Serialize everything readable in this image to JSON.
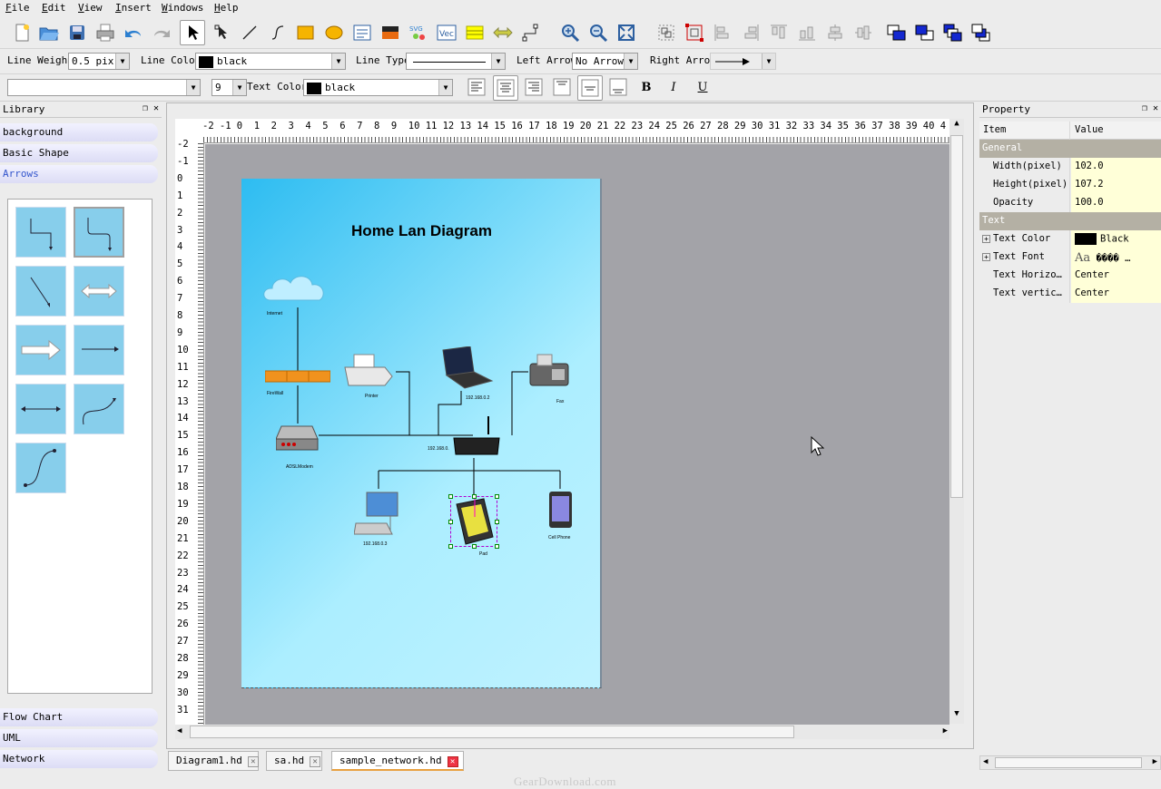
{
  "menu": [
    {
      "key": "F",
      "rest": "ile"
    },
    {
      "key": "E",
      "rest": "dit"
    },
    {
      "key": "V",
      "rest": "iew"
    },
    {
      "key": "I",
      "rest": "nsert"
    },
    {
      "key": "W",
      "rest": "indows"
    },
    {
      "key": "H",
      "rest": "elp"
    }
  ],
  "toolbar_line": {
    "line_weight_label": "Line Weight",
    "line_weight_value": "0.5 pix",
    "line_color_label": "Line Color",
    "line_color_value": "black",
    "line_type_label": "Line Type",
    "left_arrow_label": "Left Arrow",
    "left_arrow_value": "No Arrow",
    "right_arrow_label": "Right Arrow"
  },
  "toolbar_text": {
    "font_value": "",
    "size_value": "9",
    "text_color_label": "Text Color",
    "text_color_value": "black",
    "bold": "B",
    "italic": "I",
    "underline": "U"
  },
  "library": {
    "title": "Library",
    "categories_top": [
      "background",
      "Basic Shape",
      "Arrows"
    ],
    "categories_bottom": [
      "Flow Chart",
      "UML",
      "Network"
    ]
  },
  "ruler": {
    "h": [
      "-2",
      "-1",
      "0",
      "1",
      "2",
      "3",
      "4",
      "5",
      "6",
      "7",
      "8",
      "9",
      "10",
      "11",
      "12",
      "13",
      "14",
      "15",
      "16",
      "17",
      "18",
      "19",
      "20",
      "21",
      "22",
      "23",
      "24",
      "25",
      "26",
      "27",
      "28",
      "29",
      "30",
      "31",
      "32",
      "33",
      "34",
      "35",
      "36",
      "37",
      "38",
      "39",
      "40",
      "4"
    ],
    "v": [
      "-2",
      "-1",
      "0",
      "1",
      "2",
      "3",
      "4",
      "5",
      "6",
      "7",
      "8",
      "9",
      "10",
      "11",
      "12",
      "13",
      "14",
      "15",
      "16",
      "17",
      "18",
      "19",
      "20",
      "21",
      "22",
      "23",
      "24",
      "25",
      "26",
      "27",
      "28",
      "29",
      "30",
      "31"
    ]
  },
  "diagram": {
    "title": "Home Lan Diagram",
    "labels": {
      "internet": "Internet",
      "firewall": "FireWall",
      "printer": "Printer",
      "laptop_ip": "192.168.0.2",
      "fax": "Fax",
      "modem": "ADSLModem",
      "router_ip": "192.168.0.",
      "pc_ip": "192.168.0.3",
      "pad": "Pad",
      "phone": "Cell Phone"
    }
  },
  "tabs": [
    {
      "label": "Diagram1.hd"
    },
    {
      "label": "sa.hd"
    },
    {
      "label": "sample_network.hd"
    }
  ],
  "property": {
    "title": "Property",
    "header": {
      "item": "Item",
      "value": "Value"
    },
    "groups": {
      "general": "General",
      "text": "Text"
    },
    "rows": [
      {
        "item": "Width(pixel)",
        "value": "102.0"
      },
      {
        "item": "Height(pixel)",
        "value": "107.2"
      },
      {
        "item": "Opacity",
        "value": "100.0"
      },
      {
        "item": "Text Color",
        "value": "Black"
      },
      {
        "item": "Text Font",
        "value": "Aa",
        "extra": "���� …"
      },
      {
        "item": "Text Horizo…",
        "value": "Center"
      },
      {
        "item": "Text vertic…",
        "value": "Center"
      }
    ]
  },
  "watermark": "GearDownload.com"
}
